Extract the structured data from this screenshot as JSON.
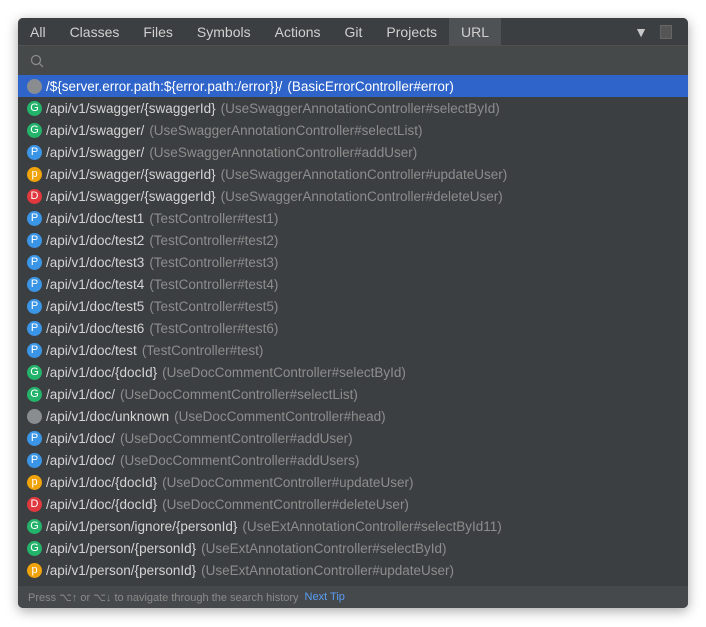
{
  "tabs": [
    "All",
    "Classes",
    "Files",
    "Symbols",
    "Actions",
    "Git",
    "Projects",
    "URL"
  ],
  "active_tab": "URL",
  "search": {
    "value": ""
  },
  "badge_colors": {
    "G": "#24b36b",
    "P": "#3b95e6",
    "p": "#f0a30a",
    "D": "#e0383e",
    "": "#8a8d90"
  },
  "selected_color": "#2f65ca",
  "items": [
    {
      "badge": "",
      "path": "/${server.error.path:${error.path:/error}}/",
      "controller": "(BasicErrorController#error)"
    },
    {
      "badge": "G",
      "path": "/api/v1/swagger/{swaggerId}",
      "controller": "(UseSwaggerAnnotationController#selectById)"
    },
    {
      "badge": "G",
      "path": "/api/v1/swagger/",
      "controller": "(UseSwaggerAnnotationController#selectList)"
    },
    {
      "badge": "P",
      "path": "/api/v1/swagger/",
      "controller": "(UseSwaggerAnnotationController#addUser)"
    },
    {
      "badge": "p",
      "path": "/api/v1/swagger/{swaggerId}",
      "controller": "(UseSwaggerAnnotationController#updateUser)"
    },
    {
      "badge": "D",
      "path": "/api/v1/swagger/{swaggerId}",
      "controller": "(UseSwaggerAnnotationController#deleteUser)"
    },
    {
      "badge": "P",
      "path": "/api/v1/doc/test1",
      "controller": "(TestController#test1)"
    },
    {
      "badge": "P",
      "path": "/api/v1/doc/test2",
      "controller": "(TestController#test2)"
    },
    {
      "badge": "P",
      "path": "/api/v1/doc/test3",
      "controller": "(TestController#test3)"
    },
    {
      "badge": "P",
      "path": "/api/v1/doc/test4",
      "controller": "(TestController#test4)"
    },
    {
      "badge": "P",
      "path": "/api/v1/doc/test5",
      "controller": "(TestController#test5)"
    },
    {
      "badge": "P",
      "path": "/api/v1/doc/test6",
      "controller": "(TestController#test6)"
    },
    {
      "badge": "P",
      "path": "/api/v1/doc/test",
      "controller": "(TestController#test)"
    },
    {
      "badge": "G",
      "path": "/api/v1/doc/{docId}",
      "controller": "(UseDocCommentController#selectById)"
    },
    {
      "badge": "G",
      "path": "/api/v1/doc/",
      "controller": "(UseDocCommentController#selectList)"
    },
    {
      "badge": "",
      "path": "/api/v1/doc/unknown",
      "controller": "(UseDocCommentController#head)"
    },
    {
      "badge": "P",
      "path": "/api/v1/doc/",
      "controller": "(UseDocCommentController#addUser)"
    },
    {
      "badge": "P",
      "path": "/api/v1/doc/",
      "controller": "(UseDocCommentController#addUsers)"
    },
    {
      "badge": "p",
      "path": "/api/v1/doc/{docId}",
      "controller": "(UseDocCommentController#updateUser)"
    },
    {
      "badge": "D",
      "path": "/api/v1/doc/{docId}",
      "controller": "(UseDocCommentController#deleteUser)"
    },
    {
      "badge": "G",
      "path": "/api/v1/person/ignore/{personId}",
      "controller": "(UseExtAnnotationController#selectById11)"
    },
    {
      "badge": "G",
      "path": "/api/v1/person/{personId}",
      "controller": "(UseExtAnnotationController#selectById)"
    },
    {
      "badge": "p",
      "path": "/api/v1/person/{personId}",
      "controller": "(UseExtAnnotationController#updateUser)"
    }
  ],
  "footer": {
    "hint": "Press ⌥↑ or ⌥↓ to navigate through the search history",
    "next_tip": "Next Tip"
  }
}
